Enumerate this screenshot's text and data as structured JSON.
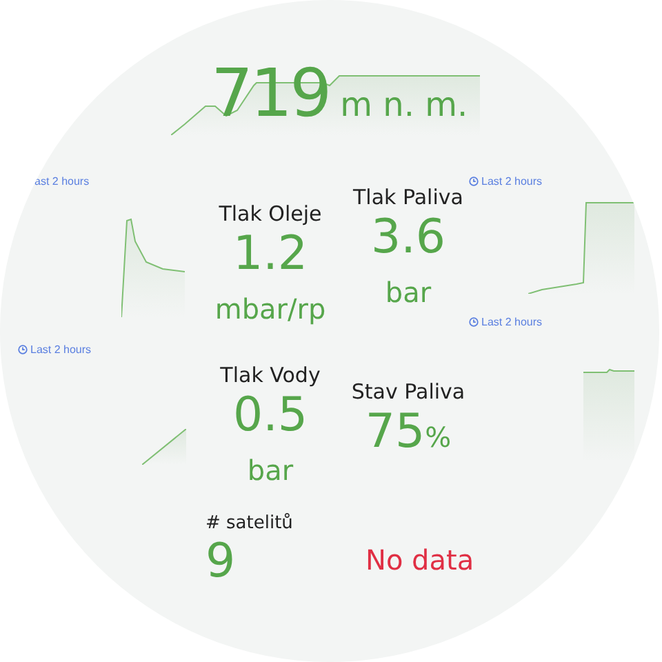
{
  "altitude": {
    "value": "719",
    "unit": "m n. m."
  },
  "time_ranges": [
    {
      "label": "ast 2 hours",
      "icon": false
    },
    {
      "label": "Last 2 hours",
      "icon": true
    },
    {
      "label": "Last 2 hours",
      "icon": true
    },
    {
      "label": "Last 2 hours",
      "icon": true
    }
  ],
  "stats": [
    {
      "title": "Tlak Oleje",
      "value": "1.2",
      "unit": "mbar/rp",
      "kind": "below"
    },
    {
      "title": "Tlak Paliva",
      "value": "3.6",
      "unit": "bar",
      "kind": "below"
    },
    {
      "title": "Tlak Vody",
      "value": "0.5",
      "unit": "bar",
      "kind": "below"
    },
    {
      "title": "Stav Paliva",
      "value": "75",
      "unit": "%",
      "kind": "inline"
    }
  ],
  "satellites": {
    "title": "# satelitů",
    "value": "9"
  },
  "no_data": {
    "text": "No data"
  }
}
